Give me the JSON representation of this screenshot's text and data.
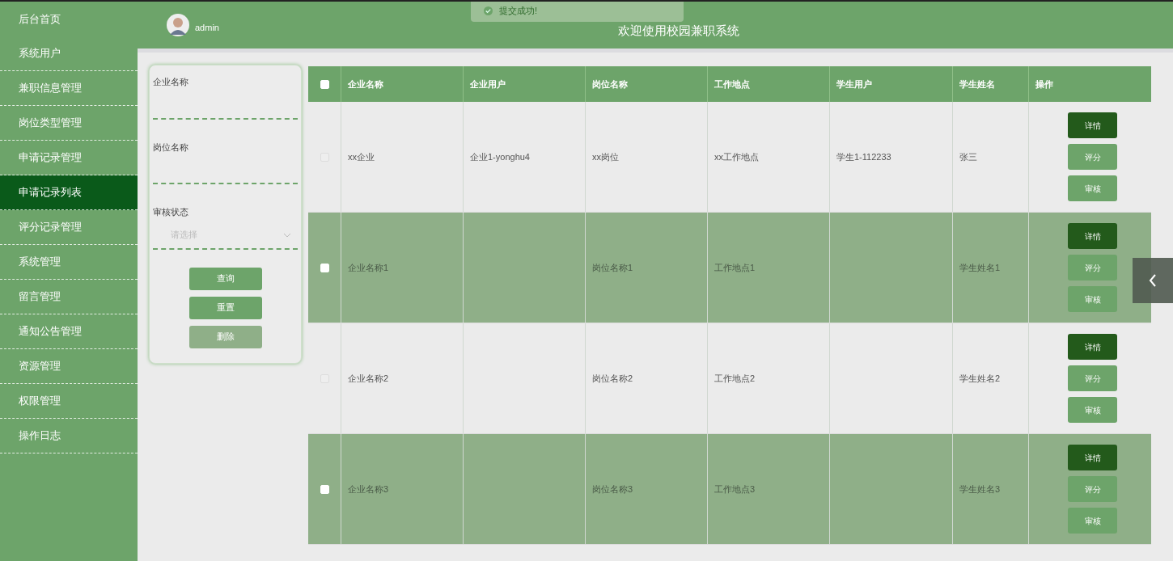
{
  "sidebar": {
    "items": [
      {
        "label": "后台首页",
        "selected": false
      },
      {
        "label": "系统用户",
        "selected": false
      },
      {
        "label": "兼职信息管理",
        "selected": false
      },
      {
        "label": "岗位类型管理",
        "selected": false
      },
      {
        "label": "申请记录管理",
        "selected": false
      },
      {
        "label": "申请记录列表",
        "selected": true
      },
      {
        "label": "评分记录管理",
        "selected": false
      },
      {
        "label": "系统管理",
        "selected": false
      },
      {
        "label": "留言管理",
        "selected": false
      },
      {
        "label": "通知公告管理",
        "selected": false
      },
      {
        "label": "资源管理",
        "selected": false
      },
      {
        "label": "权限管理",
        "selected": false
      },
      {
        "label": "操作日志",
        "selected": false
      }
    ]
  },
  "header": {
    "username": "admin",
    "title": "欢迎使用校园兼职系统",
    "toast": "提交成功!"
  },
  "search": {
    "fields": [
      {
        "kind": "text",
        "label": "企业名称"
      },
      {
        "kind": "text",
        "label": "岗位名称"
      },
      {
        "kind": "select",
        "label": "审核状态",
        "placeholder": "请选择"
      }
    ],
    "buttons": [
      {
        "label": "查询",
        "disabled": false
      },
      {
        "label": "重置",
        "disabled": false
      },
      {
        "label": "删除",
        "disabled": true
      }
    ]
  },
  "table": {
    "all_checked": false,
    "columns": [
      "企业名称",
      "企业用户",
      "岗位名称",
      "工作地点",
      "学生用户",
      "学生姓名",
      "操作"
    ],
    "rows": [
      {
        "highlighted": false,
        "checked": false,
        "cells": [
          "xx企业",
          "企业1-yonghu4",
          "xx岗位",
          "xx工作地点",
          "学生1-112233",
          "张三"
        ],
        "actions": [
          "详情",
          "评分",
          "审核"
        ]
      },
      {
        "highlighted": true,
        "checked": false,
        "cells": [
          "企业名称1",
          "",
          "岗位名称1",
          "工作地点1",
          "",
          "学生姓名1"
        ],
        "actions": [
          "详情",
          "评分",
          "审核"
        ]
      },
      {
        "highlighted": false,
        "checked": false,
        "cells": [
          "企业名称2",
          "",
          "岗位名称2",
          "工作地点2",
          "",
          "学生姓名2"
        ],
        "actions": [
          "详情",
          "评分",
          "审核"
        ]
      },
      {
        "highlighted": true,
        "checked": false,
        "cells": [
          "企业名称3",
          "",
          "岗位名称3",
          "工作地点3",
          "",
          "学生姓名3"
        ],
        "actions": [
          "详情",
          "评分",
          "审核"
        ]
      }
    ]
  }
}
